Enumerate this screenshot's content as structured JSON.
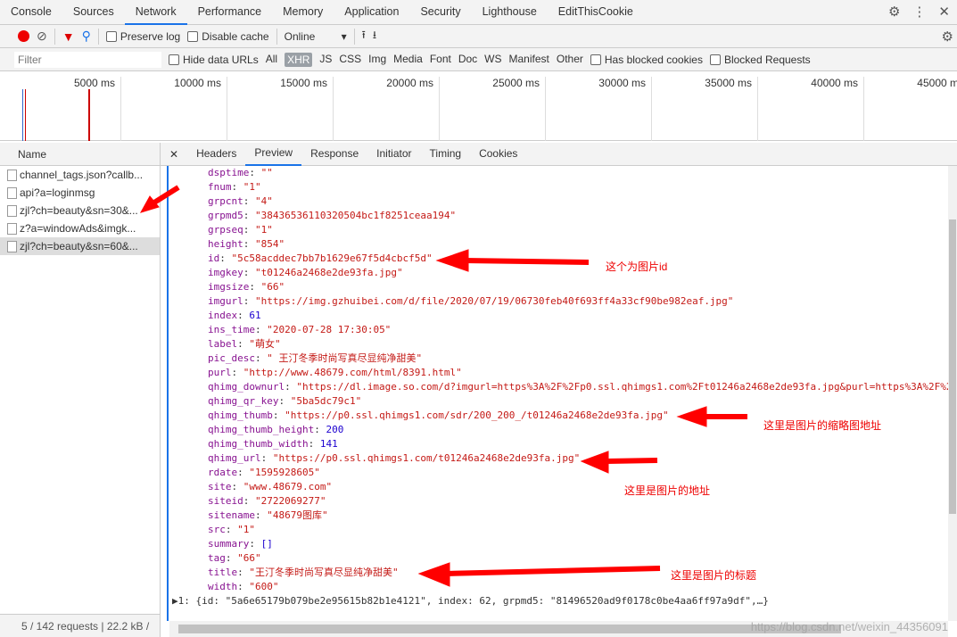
{
  "tabs": [
    "Console",
    "Sources",
    "Network",
    "Performance",
    "Memory",
    "Application",
    "Security",
    "Lighthouse",
    "EditThisCookie"
  ],
  "toolbar": {
    "preserve_log": "Preserve log",
    "disable_cache": "Disable cache",
    "throttle": "Online"
  },
  "filter": {
    "placeholder": "Filter",
    "hide_data_urls": "Hide data URLs",
    "types": [
      "All",
      "XHR",
      "JS",
      "CSS",
      "Img",
      "Media",
      "Font",
      "Doc",
      "WS",
      "Manifest",
      "Other"
    ],
    "active_type": "XHR",
    "has_blocked": "Has blocked cookies",
    "blocked_requests": "Blocked Requests"
  },
  "timeline": {
    "ticks": [
      "5000 ms",
      "10000 ms",
      "15000 ms",
      "20000 ms",
      "25000 ms",
      "30000 ms",
      "35000 ms",
      "40000 ms",
      "45000 ms"
    ]
  },
  "requests": {
    "header": "Name",
    "items": [
      "channel_tags.json?callb...",
      "api?a=loginmsg",
      "zjl?ch=beauty&sn=30&...",
      "z?a=windowAds&imgk...",
      "zjl?ch=beauty&sn=60&..."
    ],
    "selected": 4,
    "footer": "5 / 142 requests | 22.2 kB /"
  },
  "detail_tabs": [
    "Headers",
    "Preview",
    "Response",
    "Initiator",
    "Timing",
    "Cookies"
  ],
  "detail_active": "Preview",
  "preview": [
    [
      "dsptime",
      "\"\"",
      "s"
    ],
    [
      "fnum",
      "\"1\"",
      "s"
    ],
    [
      "grpcnt",
      "\"4\"",
      "s"
    ],
    [
      "grpmd5",
      "\"38436536110320504bc1f8251ceaa194\"",
      "s"
    ],
    [
      "grpseq",
      "\"1\"",
      "s"
    ],
    [
      "height",
      "\"854\"",
      "s"
    ],
    [
      "id",
      "\"5c58acddec7bb7b1629e67f5d4cbcf5d\"",
      "s"
    ],
    [
      "imgkey",
      "\"t01246a2468e2de93fa.jpg\"",
      "s"
    ],
    [
      "imgsize",
      "\"66\"",
      "s"
    ],
    [
      "imgurl",
      "\"https://img.gzhuibei.com/d/file/2020/07/19/06730feb40f693ff4a33cf90be982eaf.jpg\"",
      "s"
    ],
    [
      "index",
      "61",
      "n"
    ],
    [
      "ins_time",
      "\"2020-07-28 17:30:05\"",
      "s"
    ],
    [
      "label",
      "\"萌女\"",
      "s"
    ],
    [
      "pic_desc",
      "\" 王汀冬季时尚写真尽显纯净甜美\"",
      "s"
    ],
    [
      "purl",
      "\"http://www.48679.com/html/8391.html\"",
      "s"
    ],
    [
      "qhimg_downurl",
      "\"https://dl.image.so.com/d?imgurl=https%3A%2F%2Fp0.ssl.qhimgs1.com%2Ft01246a2468e2de93fa.jpg&purl=https%3A%2F%2",
      "s"
    ],
    [
      "qhimg_qr_key",
      "\"5ba5dc79c1\"",
      "s"
    ],
    [
      "qhimg_thumb",
      "\"https://p0.ssl.qhimgs1.com/sdr/200_200_/t01246a2468e2de93fa.jpg\"",
      "s"
    ],
    [
      "qhimg_thumb_height",
      "200",
      "n"
    ],
    [
      "qhimg_thumb_width",
      "141",
      "n"
    ],
    [
      "qhimg_url",
      "\"https://p0.ssl.qhimgs1.com/t01246a2468e2de93fa.jpg\"",
      "s"
    ],
    [
      "rdate",
      "\"1595928605\"",
      "s"
    ],
    [
      "site",
      "\"www.48679.com\"",
      "s"
    ],
    [
      "siteid",
      "\"2722069277\"",
      "s"
    ],
    [
      "sitename",
      "\"48679图库\"",
      "s"
    ],
    [
      "src",
      "\"1\"",
      "s"
    ],
    [
      "summary",
      "[]",
      "n"
    ],
    [
      "tag",
      "\"66\"",
      "s"
    ],
    [
      "title",
      "\"王汀冬季时尚写真尽显纯净甜美\"",
      "s"
    ],
    [
      "width",
      "\"600\"",
      "s"
    ]
  ],
  "next_item": "▶1: {id: \"5a6e65179b079be2e95615b82b1e4121\", index: 62, grpmd5: \"81496520ad9f0178c0be4aa6ff97a9df\",…}",
  "annotations": [
    "这个为图片id",
    "这里是图片的缩略图地址",
    "这里是图片的地址",
    "这里是图片的标题"
  ],
  "watermark": "https://blog.csdn.net/weixin_44356091",
  "colors": {
    "accent": "#1a73e8",
    "annotation": "#ff0000",
    "key": "#881391",
    "string": "#c41a16",
    "number": "#1c00cf"
  }
}
